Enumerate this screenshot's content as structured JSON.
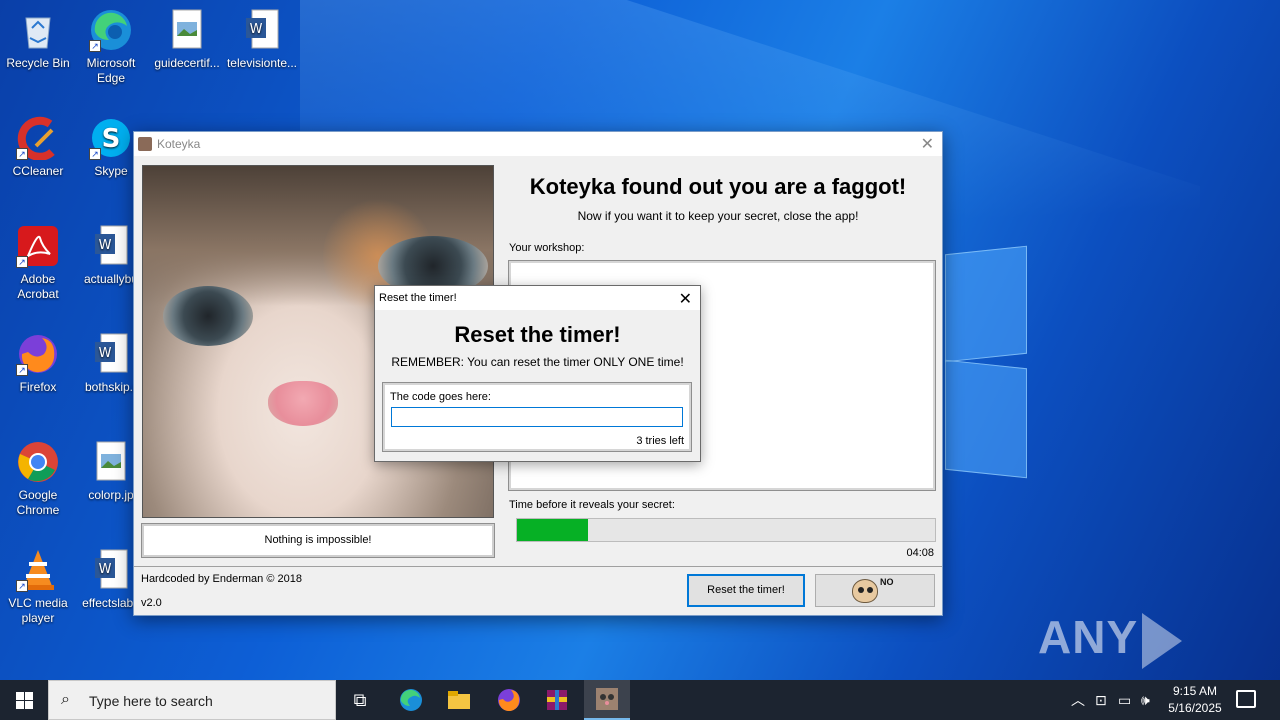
{
  "desktop": {
    "icons": [
      {
        "label": "Recycle Bin",
        "icon": "recycle-bin-icon"
      },
      {
        "label": "Microsoft Edge",
        "icon": "edge-icon"
      },
      {
        "label": "guidecertif...",
        "icon": "image-file-icon"
      },
      {
        "label": "televisionte...",
        "icon": "word-doc-icon"
      },
      {
        "label": "CCleaner",
        "icon": "ccleaner-icon"
      },
      {
        "label": "Skype",
        "icon": "skype-icon"
      },
      {
        "label": "Adobe Acrobat",
        "icon": "acrobat-icon"
      },
      {
        "label": "actuallybu",
        "icon": "word-doc-icon"
      },
      {
        "label": "Firefox",
        "icon": "firefox-icon"
      },
      {
        "label": "bothskip.r",
        "icon": "word-doc-icon"
      },
      {
        "label": "Google Chrome",
        "icon": "chrome-icon"
      },
      {
        "label": "colorp.jp",
        "icon": "image-file-icon"
      },
      {
        "label": "VLC media player",
        "icon": "vlc-icon"
      },
      {
        "label": "effectslabe",
        "icon": "word-doc-icon"
      }
    ]
  },
  "main_window": {
    "title": "Koteyka",
    "heading": "Koteyka found out you are a faggot!",
    "subheading": "Now if you want it to keep your secret, close the app!",
    "motto": "Nothing is impossible!",
    "workshop_label": "Your workshop:",
    "timer_label": "Time before it reveals your secret:",
    "timer_value": "04:08",
    "progress_fraction": 0.17,
    "credit": "Hardcoded by Enderman © 2018",
    "version": "v2.0",
    "reset_button": "Reset the timer!",
    "baldi_text": "NO"
  },
  "dialog": {
    "title": "Reset the timer!",
    "heading": "Reset the timer!",
    "subtext": "REMEMBER: You can reset the timer ONLY ONE time!",
    "code_label": "The code goes here:",
    "code_value": "",
    "tries": "3 tries left"
  },
  "watermark": {
    "left": "ANY",
    "right": "RUN"
  },
  "taskbar": {
    "search_placeholder": "Type here to search",
    "time": "9:15 AM",
    "date": "5/16/2025",
    "colors": {
      "accent": "#0078d7",
      "progress": "#06b025"
    }
  }
}
